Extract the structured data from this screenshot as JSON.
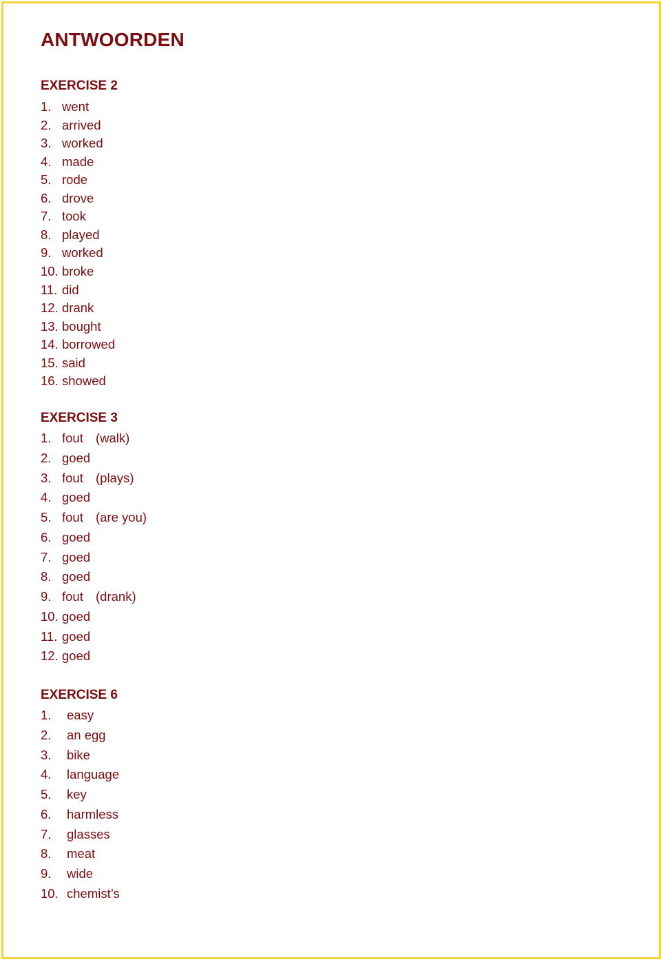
{
  "title": "ANTWOORDEN",
  "exercises": [
    {
      "heading": "EXERCISE 2",
      "items": [
        {
          "num": "1.",
          "answer": "went"
        },
        {
          "num": "2.",
          "answer": "arrived"
        },
        {
          "num": "3.",
          "answer": "worked"
        },
        {
          "num": "4.",
          "answer": "made"
        },
        {
          "num": "5.",
          "answer": "rode"
        },
        {
          "num": "6.",
          "answer": "drove"
        },
        {
          "num": "7.",
          "answer": "took"
        },
        {
          "num": "8.",
          "answer": "played"
        },
        {
          "num": "9.",
          "answer": "worked"
        },
        {
          "num": "10.",
          "answer": "broke"
        },
        {
          "num": "11.",
          "answer": "did"
        },
        {
          "num": "12.",
          "answer": "drank"
        },
        {
          "num": "13.",
          "answer": "bought"
        },
        {
          "num": "14.",
          "answer": "borrowed"
        },
        {
          "num": "15.",
          "answer": "said"
        },
        {
          "num": "16.",
          "answer": "showed"
        }
      ]
    },
    {
      "heading": "EXERCISE 3",
      "items": [
        {
          "num": "1.",
          "answer": "fout",
          "note": "(walk)"
        },
        {
          "num": "2.",
          "answer": "goed"
        },
        {
          "num": "3.",
          "answer": "fout",
          "note": "(plays)"
        },
        {
          "num": "4.",
          "answer": "goed"
        },
        {
          "num": "5.",
          "answer": "fout",
          "note": "(are you)"
        },
        {
          "num": "6.",
          "answer": "goed"
        },
        {
          "num": "7.",
          "answer": "goed"
        },
        {
          "num": "8.",
          "answer": "goed"
        },
        {
          "num": "9.",
          "answer": "fout",
          "note": "(drank)"
        },
        {
          "num": "10.",
          "answer": "goed"
        },
        {
          "num": "11.",
          "answer": "goed"
        },
        {
          "num": "12.",
          "answer": "goed"
        }
      ]
    },
    {
      "heading": "EXERCISE 6",
      "items": [
        {
          "num": "1.",
          "answer": "easy"
        },
        {
          "num": "2.",
          "answer": "an egg"
        },
        {
          "num": "3.",
          "answer": "bike"
        },
        {
          "num": "4.",
          "answer": "language"
        },
        {
          "num": "5.",
          "answer": "key"
        },
        {
          "num": "6.",
          "answer": "harmless"
        },
        {
          "num": "7.",
          "answer": "glasses"
        },
        {
          "num": "8.",
          "answer": "meat"
        },
        {
          "num": "9.",
          "answer": "wide"
        },
        {
          "num": "10.",
          "answer": "chemist’s"
        }
      ]
    }
  ]
}
